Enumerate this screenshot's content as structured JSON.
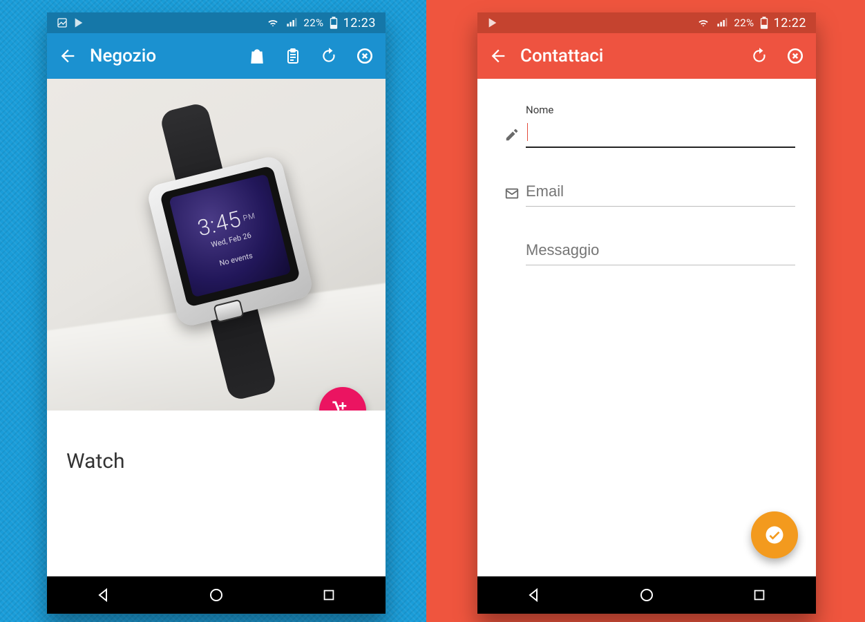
{
  "left": {
    "status": {
      "battery": "22%",
      "time": "12:23"
    },
    "appbar": {
      "title": "Negozio"
    },
    "product": {
      "title": "Watch",
      "watchface": {
        "time": "3:45",
        "ampm": "PM",
        "date": "Wed, Feb 26",
        "noevents": "No events"
      }
    }
  },
  "right": {
    "status": {
      "battery": "22%",
      "time": "12:22"
    },
    "appbar": {
      "title": "Contattaci"
    },
    "form": {
      "name_label": "Nome",
      "name_value": "",
      "email_placeholder": "Email",
      "message_placeholder": "Messaggio"
    }
  }
}
